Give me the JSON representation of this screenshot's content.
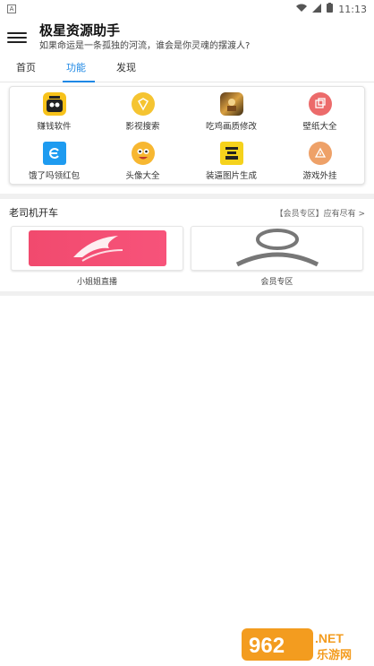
{
  "status_bar": {
    "left_icon": "A",
    "time": "11:13"
  },
  "header": {
    "title": "极星资源助手",
    "subtitle": "如果命运是一条孤独的河流，谁会是你灵魂的摆渡人?"
  },
  "tabs": [
    {
      "label": "首页",
      "active": false
    },
    {
      "label": "功能",
      "active": true
    },
    {
      "label": "发现",
      "active": false
    }
  ],
  "functions": [
    {
      "label": "赚钱软件",
      "icon": "earn-icon"
    },
    {
      "label": "影视搜索",
      "icon": "video-search-icon"
    },
    {
      "label": "吃鸡画质修改",
      "icon": "game-quality-icon"
    },
    {
      "label": "壁纸大全",
      "icon": "wallpaper-icon"
    },
    {
      "label": "饿了吗领红包",
      "icon": "eleme-icon"
    },
    {
      "label": "头像大全",
      "icon": "avatar-icon"
    },
    {
      "label": "装逼图片生成",
      "icon": "image-maker-icon"
    },
    {
      "label": "游戏外挂",
      "icon": "game-cheat-icon"
    }
  ],
  "section": {
    "title": "老司机开车",
    "more": "【会员专区】应有尽有 >"
  },
  "cards": [
    {
      "label": "小姐姐直播"
    },
    {
      "label": "会员专区"
    }
  ],
  "watermark": {
    "text1": "962",
    "text2": ".NET",
    "text3": "乐游网"
  }
}
